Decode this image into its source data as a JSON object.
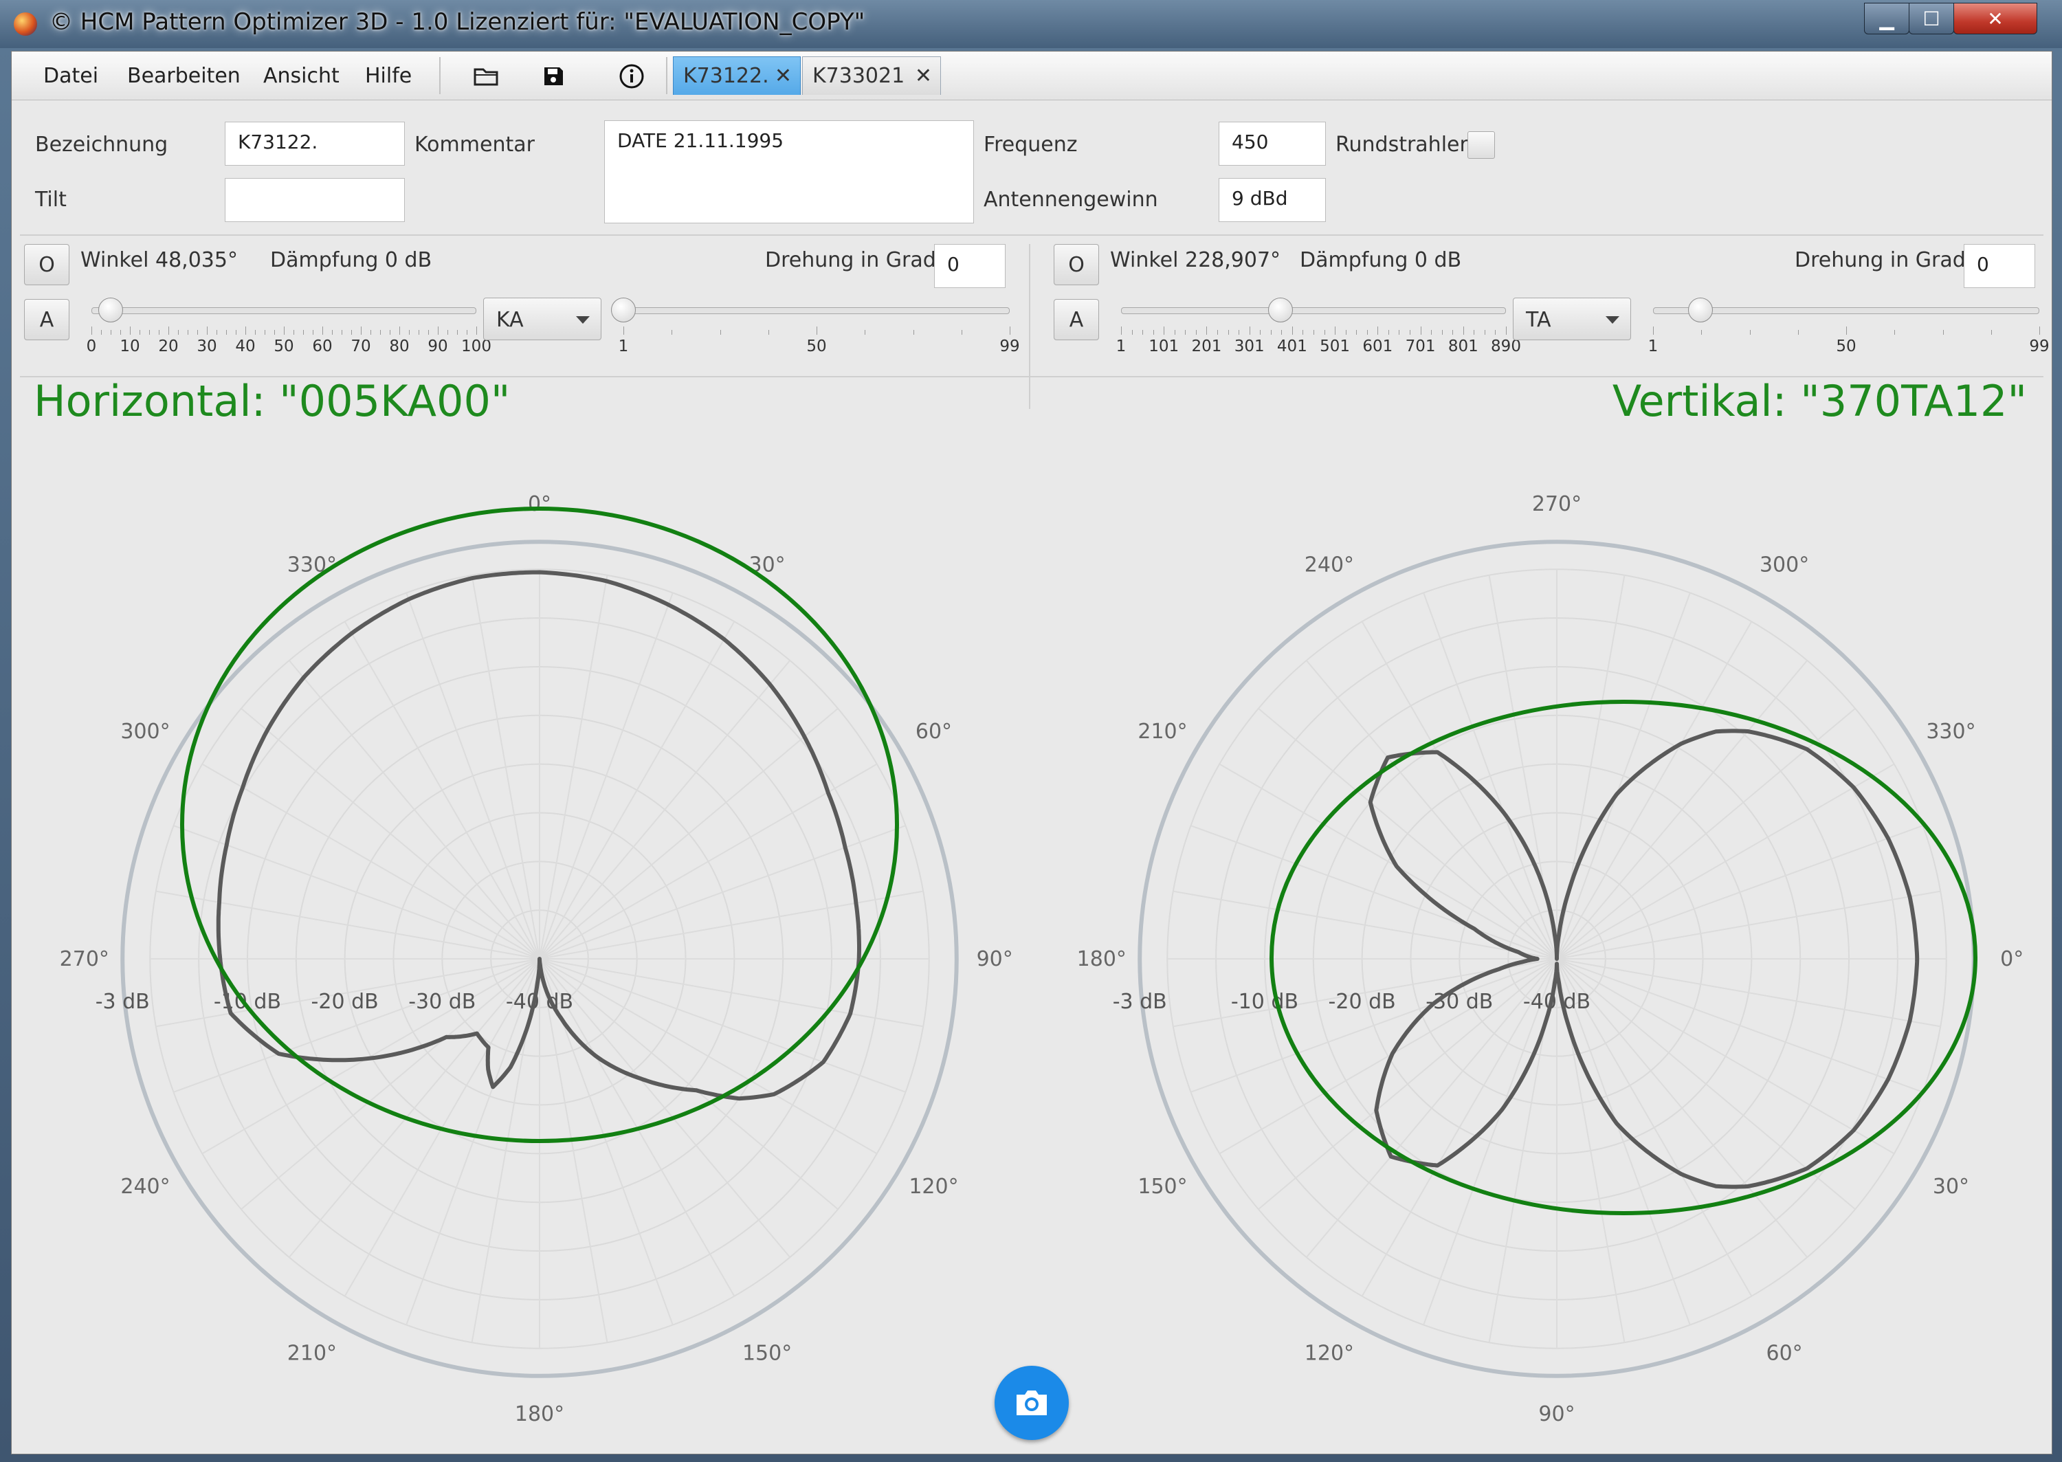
{
  "window": {
    "title": "© HCM Pattern Optimizer 3D - 1.0 Lizenziert für: \"EVALUATION_COPY\"",
    "controls": {
      "minimize": "▁",
      "maximize": "☐",
      "close": "✕"
    }
  },
  "menu": {
    "file": "Datei",
    "edit": "Bearbeiten",
    "view": "Ansicht",
    "help": "Hilfe"
  },
  "toolbar_icons": [
    "folder-open-icon",
    "save-icon",
    "info-icon"
  ],
  "tabs": [
    {
      "label": "K73122.",
      "active": true,
      "close": "✕"
    },
    {
      "label": "K733021",
      "active": false,
      "close": "✕"
    }
  ],
  "form": {
    "bezeichnung_label": "Bezeichnung",
    "bezeichnung_value": "K73122.",
    "tilt_label": "Tilt",
    "tilt_value": "",
    "kommentar_label": "Kommentar",
    "kommentar_value": "DATE 21.11.1995",
    "frequenz_label": "Frequenz",
    "frequenz_value": "450",
    "antennengewinn_label": "Antennengewinn",
    "antennengewinn_value": "9 dBd",
    "rundstrahler_label": "Rundstrahler",
    "rundstrahler_checked": false
  },
  "left_panel": {
    "o_label": "O",
    "a_label": "A",
    "winkel": "Winkel 48,035°",
    "daempfung": "Dämpfung 0 dB",
    "drehung_label": "Drehung in Grad",
    "drehung_value": "0",
    "combo": "KA",
    "slider1": {
      "value": 5,
      "min": 0,
      "max": 100,
      "labels": [
        "0",
        "10",
        "20",
        "30",
        "40",
        "50",
        "60",
        "70",
        "80",
        "90",
        "100"
      ]
    },
    "slider2": {
      "value": 1,
      "min": 1,
      "max": 99,
      "labels": [
        "1",
        "50",
        "99"
      ]
    }
  },
  "right_panel": {
    "o_label": "O",
    "a_label": "A",
    "winkel": "Winkel 228,907°",
    "daempfung": "Dämpfung 0 dB",
    "drehung_label": "Drehung in Grad",
    "drehung_value": "0",
    "combo": "TA",
    "slider1": {
      "value": 370,
      "min": 1,
      "max": 890,
      "labels": [
        "1",
        "101",
        "201",
        "301",
        "401",
        "501",
        "601",
        "701",
        "801",
        "890"
      ]
    },
    "slider2": {
      "value": 13,
      "min": 1,
      "max": 99,
      "labels": [
        "1",
        "50",
        "99"
      ]
    }
  },
  "chart_data": [
    {
      "type": "polar",
      "title": "Horizontal: \"005KA00\"",
      "angle_labels": [
        "0°",
        "30°",
        "60°",
        "90°",
        "120°",
        "150°",
        "180°",
        "210°",
        "240°",
        "270°",
        "300°",
        "330°"
      ],
      "angle_zero": "top",
      "direction": "clockwise",
      "radial_labels": [
        "-3 dB",
        "-10 dB",
        "-20 dB",
        "-30 dB",
        "-40 dB"
      ],
      "colors": {
        "pattern": "#5a5a5a",
        "envelope": "#128012",
        "outer_ring": "#b9c0c7"
      },
      "series": [
        {
          "angle_deg": [
            0,
            10,
            20,
            30,
            40,
            50,
            60,
            70,
            80,
            90,
            100,
            110,
            120,
            125,
            130,
            140,
            150,
            155,
            160,
            165,
            170,
            175,
            180,
            185,
            190,
            195,
            200,
            205,
            210,
            220,
            230,
            240,
            250,
            260,
            270,
            280,
            290,
            300,
            310,
            320,
            330,
            340,
            350
          ],
          "level_db": [
            -0.3,
            -0.6,
            -1.3,
            -2.1,
            -3.2,
            -4.5,
            -5.8,
            -6.6,
            -7.0,
            -7.2,
            -7.6,
            -9.0,
            -12.2,
            -15.0,
            -19.0,
            -24.0,
            -28.5,
            -31.0,
            -33.5,
            -35.5,
            -37.5,
            -39.5,
            -40.0,
            -37.5,
            -33.0,
            -28.5,
            -26.0,
            -27.5,
            -29.5,
            -30.0,
            -27.5,
            -19.5,
            -11.5,
            -7.8,
            -7.2,
            -6.6,
            -5.8,
            -4.8,
            -3.5,
            -2.3,
            -1.4,
            -0.7,
            -0.3
          ]
        }
      ]
    },
    {
      "type": "polar",
      "title": "Vertikal: \"370TA12\"",
      "angle_labels": [
        "270°",
        "300°",
        "330°",
        "0°",
        "30°",
        "60°",
        "90°",
        "120°",
        "150°",
        "180°",
        "210°",
        "240°"
      ],
      "angle_zero": "right",
      "direction": "counterclockwise",
      "radial_labels": [
        "-3 dB",
        "-10 dB",
        "-20 dB",
        "-30 dB",
        "-40 dB"
      ],
      "colors": {
        "pattern": "#5a5a5a",
        "envelope": "#128012",
        "outer_ring": "#b9c0c7"
      },
      "series": [
        {
          "angle_deg": [
            0,
            10,
            20,
            30,
            40,
            50,
            55,
            60,
            70,
            80,
            85,
            90,
            95,
            100,
            110,
            120,
            130,
            140,
            150,
            160,
            170,
            175,
            180,
            185,
            190,
            200,
            210,
            220,
            230,
            240,
            250,
            260,
            265,
            270,
            275,
            280,
            290,
            300,
            305,
            310,
            320,
            330,
            340,
            350
          ],
          "level_db": [
            -3.0,
            -3.2,
            -3.8,
            -4.8,
            -6.5,
            -9.5,
            -11.5,
            -14.5,
            -22.0,
            -33.0,
            -37.5,
            -40.0,
            -37.5,
            -33.0,
            -24.0,
            -15.5,
            -13.0,
            -15.0,
            -21.0,
            -31.0,
            -36.0,
            -37.0,
            -38.0,
            -36.5,
            -34.0,
            -26.5,
            -20.5,
            -15.8,
            -13.5,
            -15.5,
            -23.5,
            -33.5,
            -37.5,
            -39.5,
            -37.5,
            -33.0,
            -22.0,
            -14.5,
            -11.5,
            -9.5,
            -6.5,
            -4.8,
            -3.8,
            -3.2
          ]
        }
      ]
    }
  ]
}
